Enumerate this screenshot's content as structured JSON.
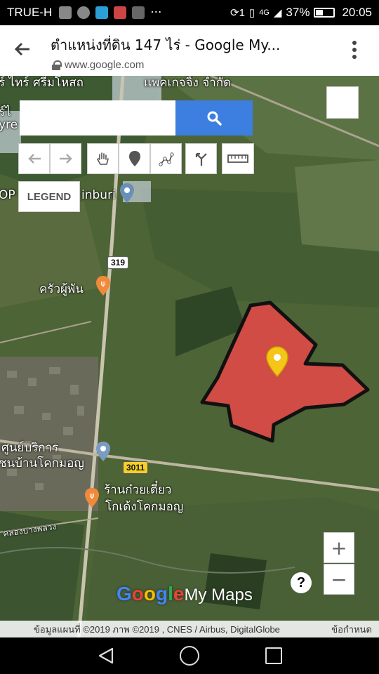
{
  "status_bar": {
    "carrier": "TRUE-H",
    "more_indicator": "···",
    "sim_indicator": "1",
    "network": "4G",
    "battery_percent": "37%",
    "time": "20:05"
  },
  "browser": {
    "title": "ตำแหน่งที่ดิน 147 ไร่ - Google My...",
    "url": "www.google.com"
  },
  "map": {
    "search": {
      "value": "",
      "placeholder": ""
    },
    "toolbar": {
      "undo_icon": "undo-icon",
      "redo_icon": "redo-icon",
      "pan_icon": "hand-icon",
      "marker_icon": "marker-icon",
      "draw_line_icon": "draw-line-icon",
      "directions_icon": "directions-icon",
      "measure_icon": "ruler-icon"
    },
    "legend_label": "LEGEND",
    "labels": {
      "top_left_1": "ร์ ไทร์ ศรีมโหสถ",
      "top_left_2": "แพคเกจจิ้ง จำกัด",
      "left_fragment_1": "ร์ไ",
      "left_fragment_2": "yre",
      "op_fragment": "OP",
      "inburi": "inburi",
      "restaurant_1": "ครัวผู้พัน",
      "service_center_1": "ศูนย์บริการ",
      "service_center_2": "ชนบ้านโคกมอญ",
      "restaurant_2_line1": "ร้านก๋วยเตี๋ยว",
      "restaurant_2_line2": "โกเด้งโคกมอญ",
      "canal": "คลองบางพลวง"
    },
    "road_shields": {
      "highway_319": "319",
      "highway_3011": "3011"
    },
    "zoom_in": "+",
    "zoom_out": "−",
    "help": "?",
    "watermark_google": "Google",
    "watermark_mymaps": "My Maps",
    "attribution": "ข้อมูลแผนที่ ©2019 ภาพ ©2019 , CNES / Airbus, DigitalGlobe",
    "terms": "ข้อกำหนด",
    "colors": {
      "parcel_fill": "#e84848",
      "parcel_stroke": "#111111",
      "marker": "#f5c518",
      "search_button": "#3d7fe0"
    }
  }
}
